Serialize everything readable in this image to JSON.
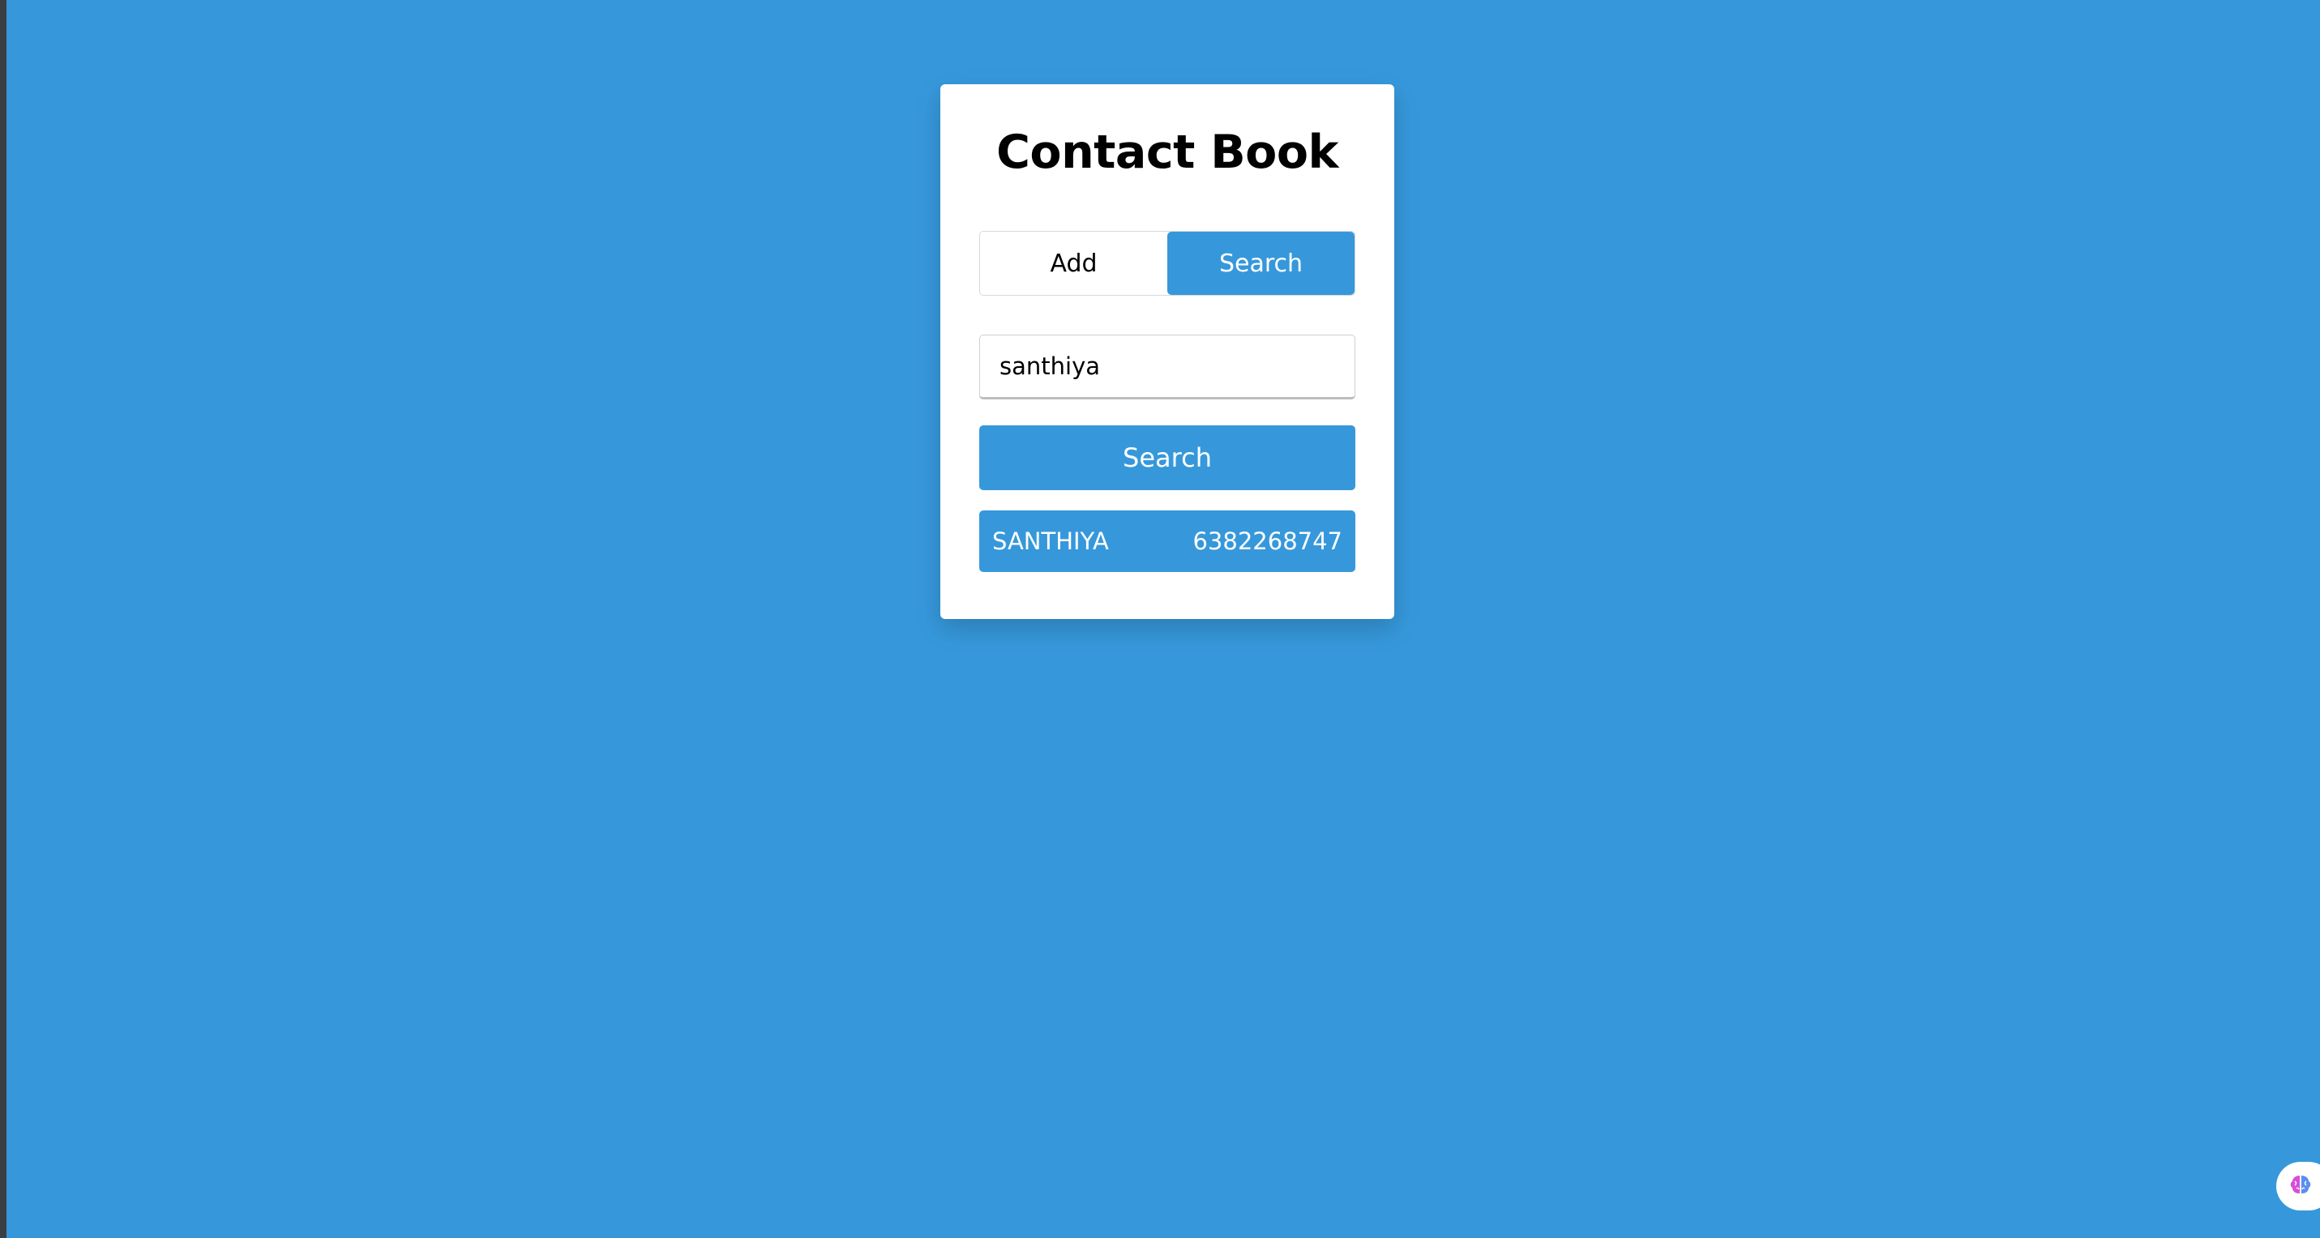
{
  "app": {
    "title": "Contact Book"
  },
  "tabs": [
    {
      "label": "Add",
      "active": false
    },
    {
      "label": "Search",
      "active": true
    }
  ],
  "search": {
    "value": "santhiya",
    "button_label": "Search"
  },
  "results": [
    {
      "name": "SANTHIYA",
      "phone": "6382268747"
    }
  ],
  "colors": {
    "accent": "#3698db",
    "card": "#ffffff"
  },
  "icons": {
    "floating": "brain-icon"
  }
}
